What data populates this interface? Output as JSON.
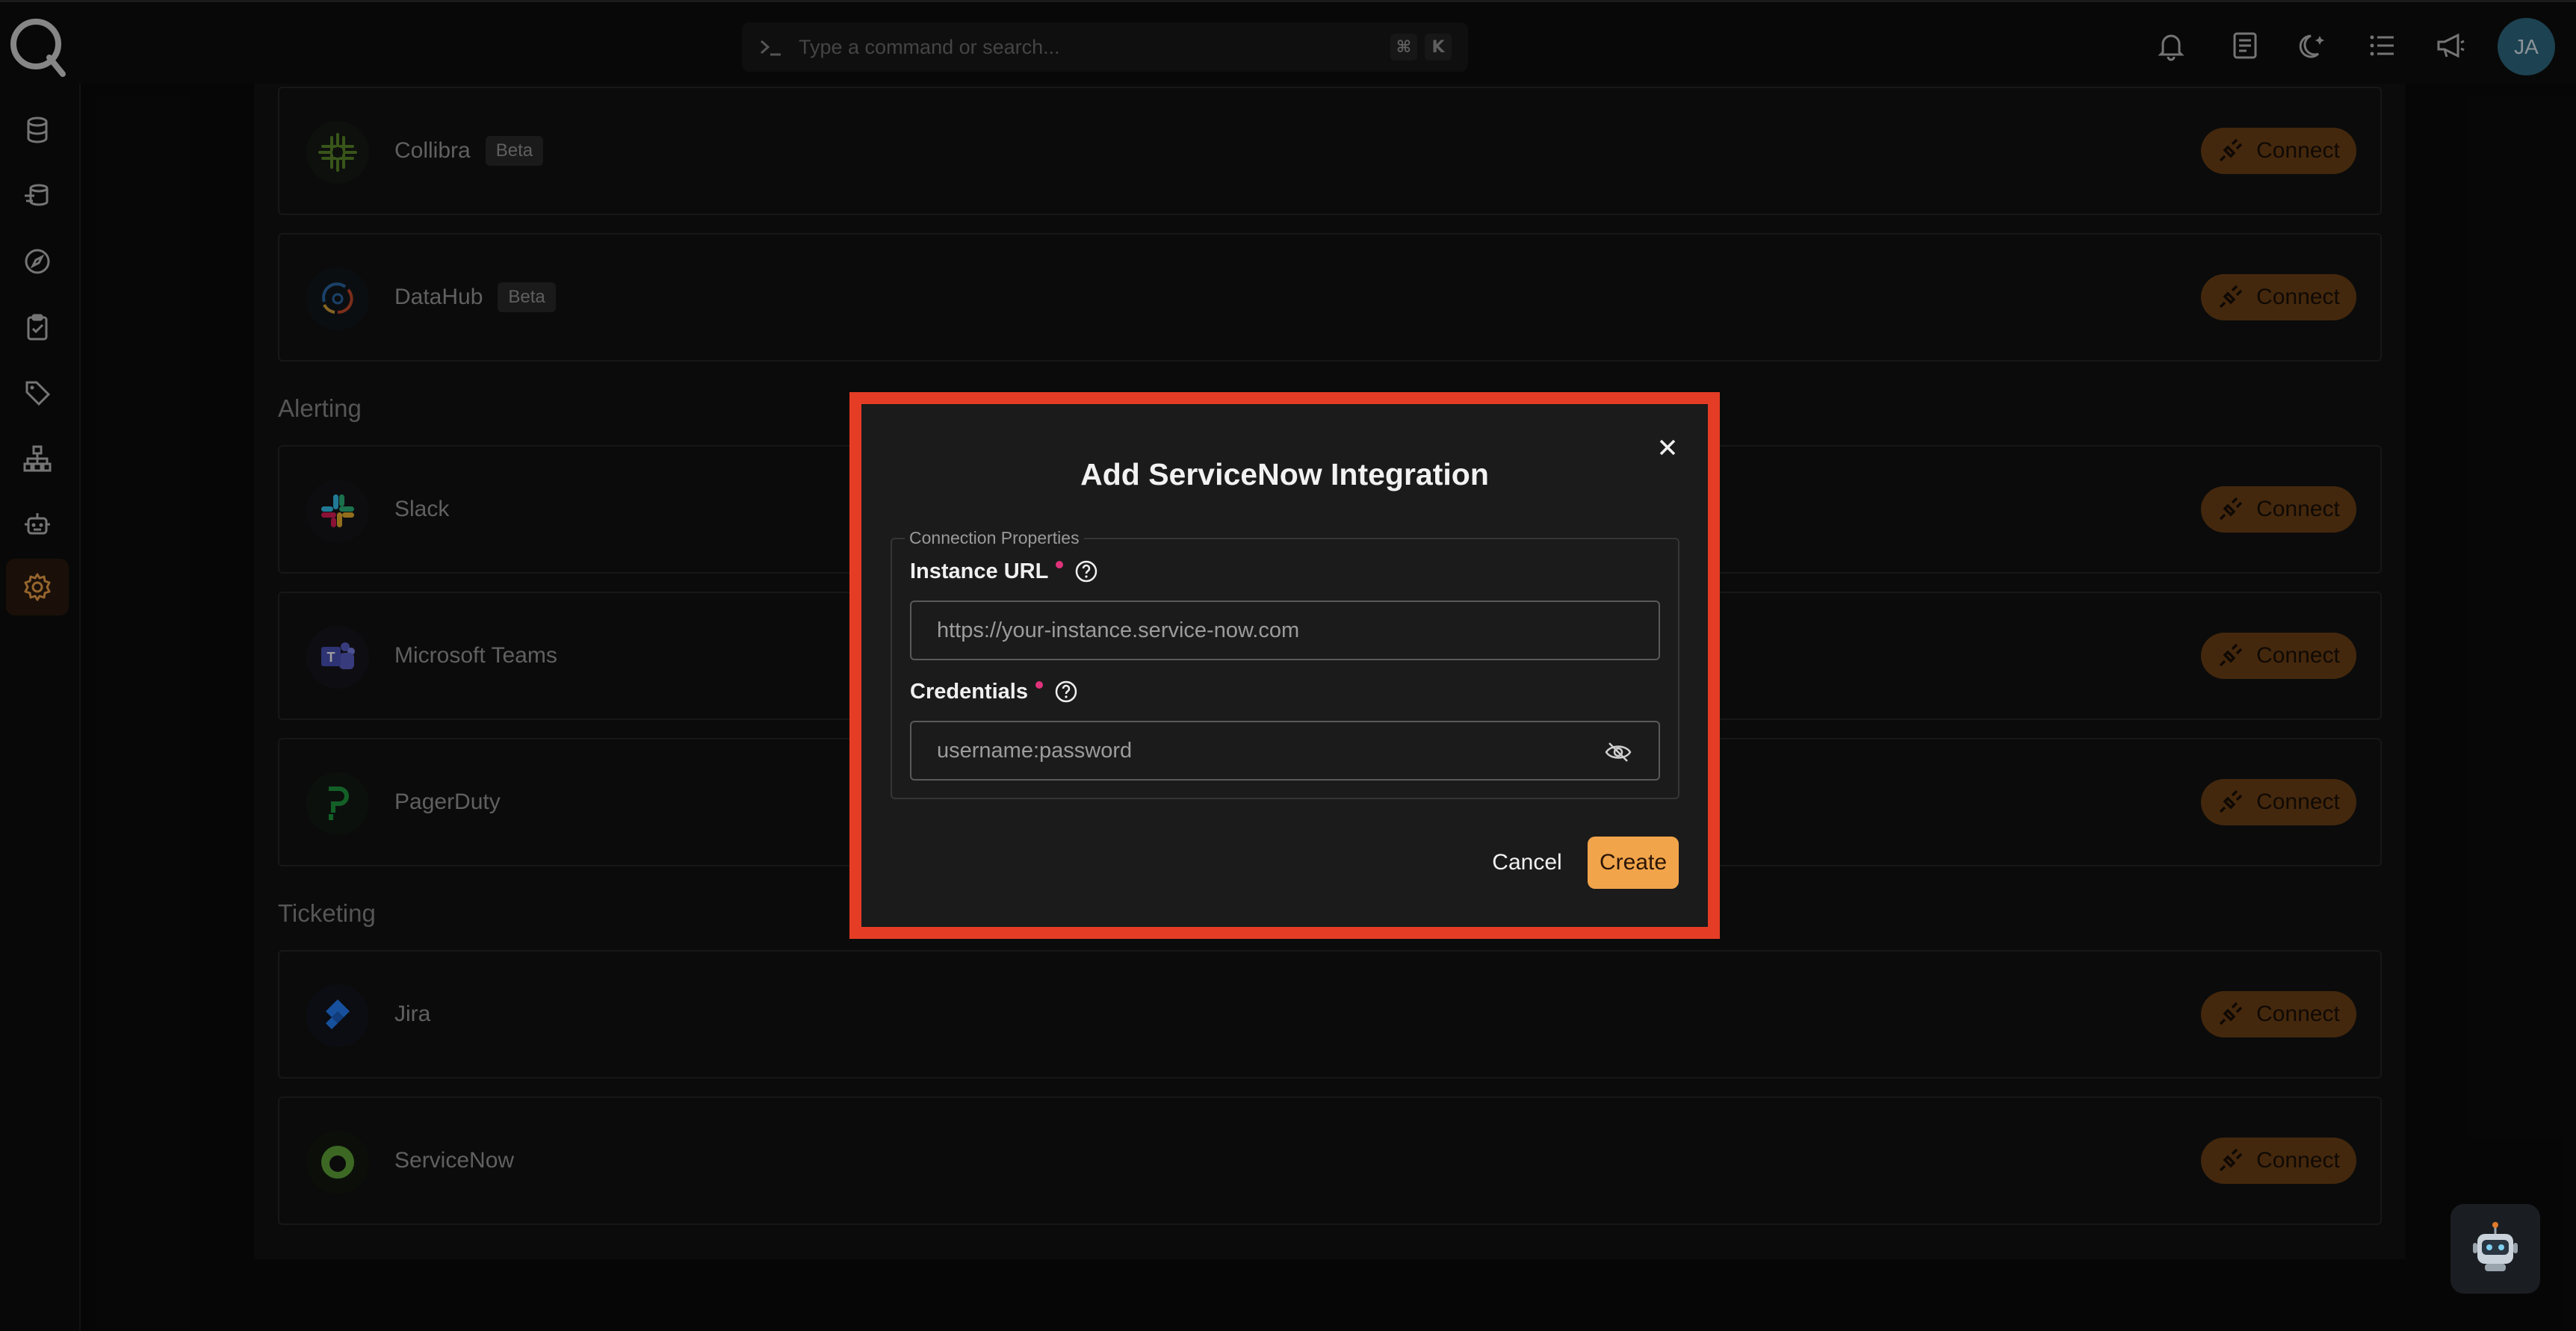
{
  "topbar": {
    "search_placeholder": "Type a command or search...",
    "shortcut_key_1": "⌘",
    "shortcut_key_2": "K",
    "avatar_initials": "JA"
  },
  "sections": {
    "alerting": "Alerting",
    "ticketing": "Ticketing"
  },
  "integrations": [
    {
      "name": "Collibra",
      "badge": "Beta",
      "action": "Connect"
    },
    {
      "name": "DataHub",
      "badge": "Beta",
      "action": "Connect"
    },
    {
      "name": "Slack",
      "action": "Connect"
    },
    {
      "name": "Microsoft Teams",
      "action": "Connect"
    },
    {
      "name": "PagerDuty",
      "action": "Connect"
    },
    {
      "name": "Jira",
      "action": "Connect"
    },
    {
      "name": "ServiceNow",
      "action": "Connect"
    }
  ],
  "modal": {
    "title": "Add ServiceNow Integration",
    "group_label": "Connection Properties",
    "instance_url_label": "Instance URL",
    "instance_url_placeholder": "https://your-instance.service-now.com",
    "credentials_label": "Credentials",
    "credentials_placeholder": "username:password",
    "cancel_label": "Cancel",
    "create_label": "Create"
  },
  "colors": {
    "accent": "#f2a44a",
    "connect_button": "#6e4216",
    "highlight": "#e53d25",
    "required_dot": "#e0327a",
    "avatar": "#2f6b84"
  }
}
